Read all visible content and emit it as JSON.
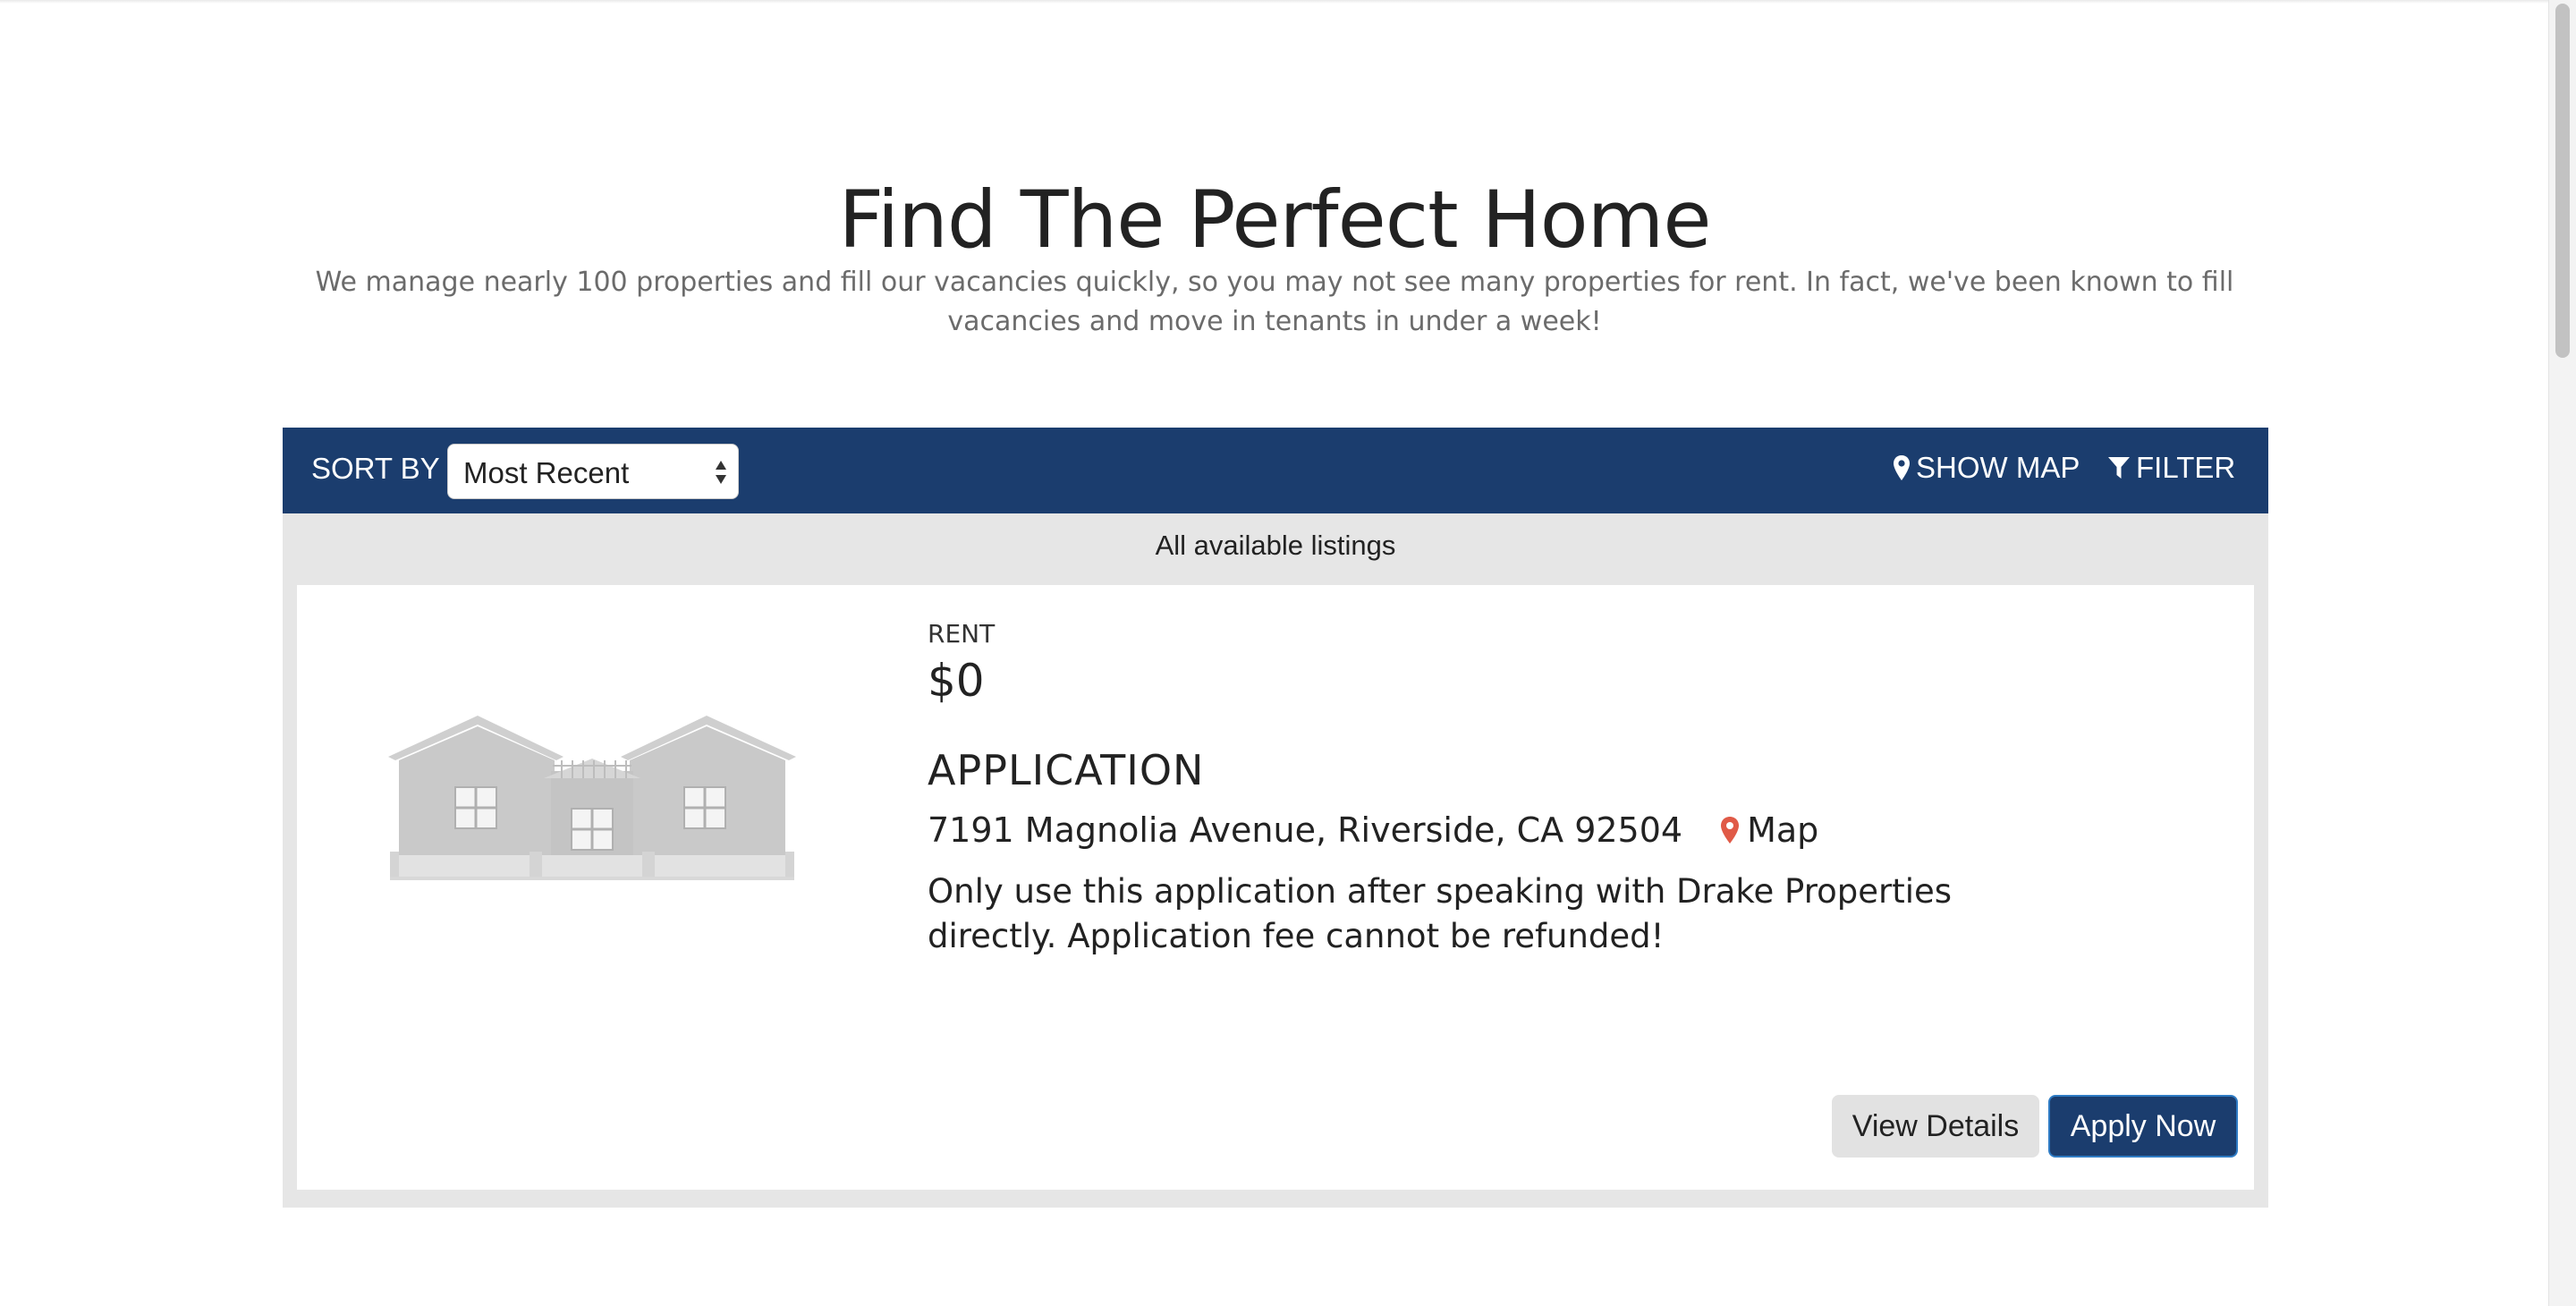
{
  "hero": {
    "title": "Find The Perfect Home",
    "subtitle": "We manage nearly 100 properties and fill our vacancies quickly, so you may not see many properties for rent. In fact, we've been known to fill vacancies and move in tenants in under a week!"
  },
  "toolbar": {
    "sort_label": "SORT BY",
    "sort_value": "Most Recent",
    "show_map_label": "SHOW MAP",
    "filter_label": "FILTER",
    "background_color": "#1b3d6e"
  },
  "listings": {
    "header": "All available listings",
    "items": [
      {
        "rent_label": "RENT",
        "rent_value": "$0",
        "title": "APPLICATION",
        "address": "7191 Magnolia Avenue, Riverside, CA 92504",
        "map_label": "Map",
        "description": "Only use this application after speaking with Drake Properties directly. Application fee cannot be refunded!",
        "view_details_label": "View Details",
        "apply_label": "Apply Now",
        "image_icon": "house-placeholder-icon"
      }
    ]
  },
  "colors": {
    "brand_navy": "#1b3d6e",
    "map_pin": "#e05a47",
    "panel_gray": "#e6e6e6"
  }
}
